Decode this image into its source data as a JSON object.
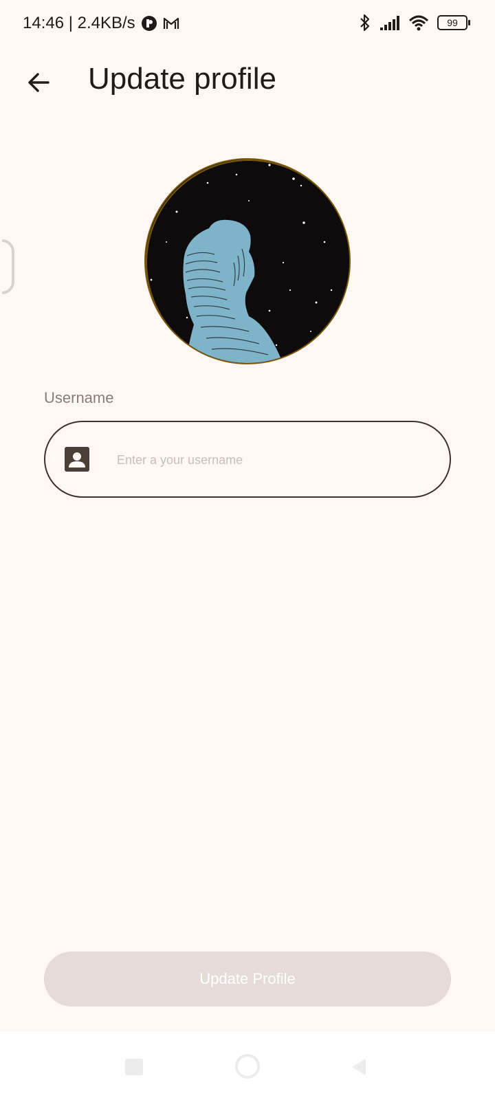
{
  "status_bar": {
    "time_speed": "14:46 | 2.4KB/s",
    "battery": "99"
  },
  "app_bar": {
    "title": "Update profile",
    "back_icon": "arrow-left-icon"
  },
  "avatar": {
    "icon": "avatar-image"
  },
  "username": {
    "label": "Username",
    "placeholder": "Enter a your username",
    "value": "",
    "icon": "contact-card-icon"
  },
  "update_button": {
    "label": "Update Profile"
  },
  "colors": {
    "background": "#FFF7F3",
    "button_disabled": "#E5DCD8",
    "field_border": "#3B322D",
    "label": "#857D7A",
    "placeholder": "#C6BEBB"
  },
  "nav_bar": {
    "recents_icon": "square-icon",
    "home_icon": "circle-icon",
    "back_icon": "triangle-back-icon"
  }
}
